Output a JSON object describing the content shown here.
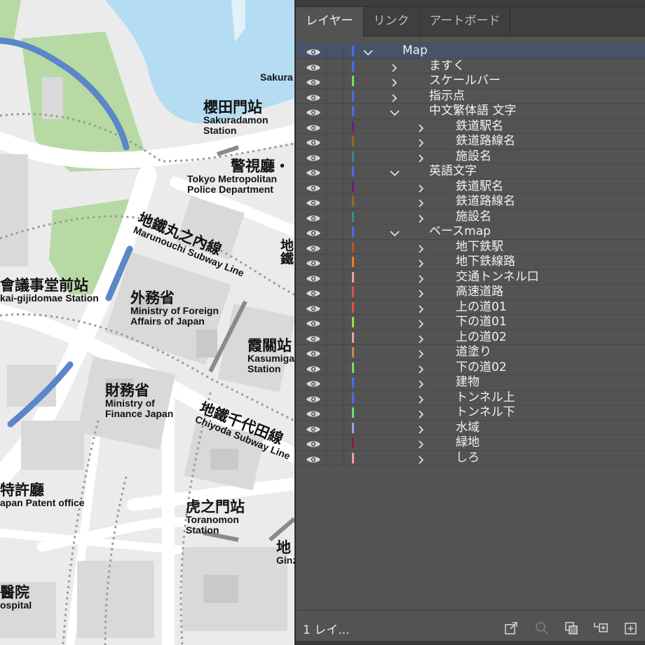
{
  "panel": {
    "tabs": [
      {
        "label": "レイヤー",
        "active": true
      },
      {
        "label": "リンク",
        "active": false
      },
      {
        "label": "アートボード",
        "active": false
      }
    ],
    "footer_count": "1 レイ...",
    "footer_icons": [
      "export-icon",
      "search-icon",
      "clipping-mask-icon",
      "new-sublayer-icon",
      "new-layer-icon"
    ]
  },
  "layers": [
    {
      "name": "Map",
      "depth": 0,
      "expanded": true,
      "color": "#4a6cf0",
      "selected": true
    },
    {
      "name": "ますく",
      "depth": 1,
      "expanded": false,
      "color": "#4a6cf0"
    },
    {
      "name": "スケールバー",
      "depth": 1,
      "expanded": false,
      "color": "#6fe06f"
    },
    {
      "name": "指示点",
      "depth": 1,
      "expanded": false,
      "color": "#4a6cf0"
    },
    {
      "name": "中文繁体語 文字",
      "depth": 1,
      "expanded": true,
      "color": "#4a6cf0"
    },
    {
      "name": "鉄道駅名",
      "depth": 2,
      "expanded": false,
      "color": "#6b1f7a"
    },
    {
      "name": "鉄道路線名",
      "depth": 2,
      "expanded": false,
      "color": "#a0622a"
    },
    {
      "name": "施設名",
      "depth": 2,
      "expanded": false,
      "color": "#3a8c8c"
    },
    {
      "name": "英語文字",
      "depth": 1,
      "expanded": true,
      "color": "#4a6cf0"
    },
    {
      "name": "鉄道駅名",
      "depth": 2,
      "expanded": false,
      "color": "#6b1f7a"
    },
    {
      "name": "鉄道路線名",
      "depth": 2,
      "expanded": false,
      "color": "#a0622a"
    },
    {
      "name": "施設名",
      "depth": 2,
      "expanded": false,
      "color": "#3a8c8c"
    },
    {
      "name": "ベースmap",
      "depth": 1,
      "expanded": true,
      "color": "#4a6cf0"
    },
    {
      "name": "地下鉄駅",
      "depth": 2,
      "expanded": false,
      "color": "#c0552a"
    },
    {
      "name": "地下鉄線路",
      "depth": 2,
      "expanded": false,
      "color": "#f07a2a"
    },
    {
      "name": "交通トンネル口",
      "depth": 2,
      "expanded": false,
      "color": "#f0a0a0"
    },
    {
      "name": "高速道路",
      "depth": 2,
      "expanded": false,
      "color": "#e05050"
    },
    {
      "name": "上の道01",
      "depth": 2,
      "expanded": false,
      "color": "#e05050"
    },
    {
      "name": "下の道01",
      "depth": 2,
      "expanded": false,
      "color": "#a0e040"
    },
    {
      "name": "上の道02",
      "depth": 2,
      "expanded": false,
      "color": "#f0a0a0"
    },
    {
      "name": "道塗り",
      "depth": 2,
      "expanded": false,
      "color": "#c0904a"
    },
    {
      "name": "下の道02",
      "depth": 2,
      "expanded": false,
      "color": "#6fe06f"
    },
    {
      "name": "建物",
      "depth": 2,
      "expanded": false,
      "color": "#4a6cf0"
    },
    {
      "name": "トンネル上",
      "depth": 2,
      "expanded": false,
      "color": "#4a6cf0"
    },
    {
      "name": "トンネル下",
      "depth": 2,
      "expanded": false,
      "color": "#6fe06f"
    },
    {
      "name": "水域",
      "depth": 2,
      "expanded": false,
      "color": "#a0a0f0"
    },
    {
      "name": "緑地",
      "depth": 2,
      "expanded": false,
      "color": "#8a1f3a"
    },
    {
      "name": "しろ",
      "depth": 2,
      "expanded": false,
      "color": "#f0a0a0"
    }
  ],
  "map": {
    "labels": {
      "sakura_partial": "Sakura",
      "sakuradamon_ja": "櫻田門站",
      "sakuradamon_en1": "Sakuradamon",
      "sakuradamon_en2": "Station",
      "keishicho_ja": "警視廳・",
      "keishicho_en1": "Tokyo Metropolitan",
      "keishicho_en2": "Police Department",
      "marunouchi_ja": "地鐵丸之內線",
      "marunouchi_en": "Marunouchi Subway Line",
      "kokkai_ja": "會議事堂前站",
      "kokkai_en": "kai-gijidomae Station",
      "gaimusho_ja": "外務省",
      "gaimusho_en1": "Ministry of Foreign",
      "gaimusho_en2": "Affairs of Japan",
      "kasumigaseki_ja": "霞關站",
      "kasumigaseki_en1": "Kasumiga",
      "kasumigaseki_en2": "Station",
      "zaimusho_ja": "財務省",
      "zaimusho_en1": "Ministry of",
      "zaimusho_en2": "Finance Japan",
      "chiyoda_ja": "地鐵千代田線",
      "chiyoda_en": "Chiyoda Subway Line",
      "tokkyo_ja": "特許廳",
      "tokkyo_en": "apan Patent office",
      "toranomon_ja": "虎之門站",
      "toranomon_en1": "Toranomon",
      "toranomon_en2": "Station",
      "ginza_ja": "地",
      "ginza_en": "Ginz",
      "hospital_ja": "醫院",
      "hospital_en": "ospital",
      "vertical_ja": "地鐵"
    }
  }
}
